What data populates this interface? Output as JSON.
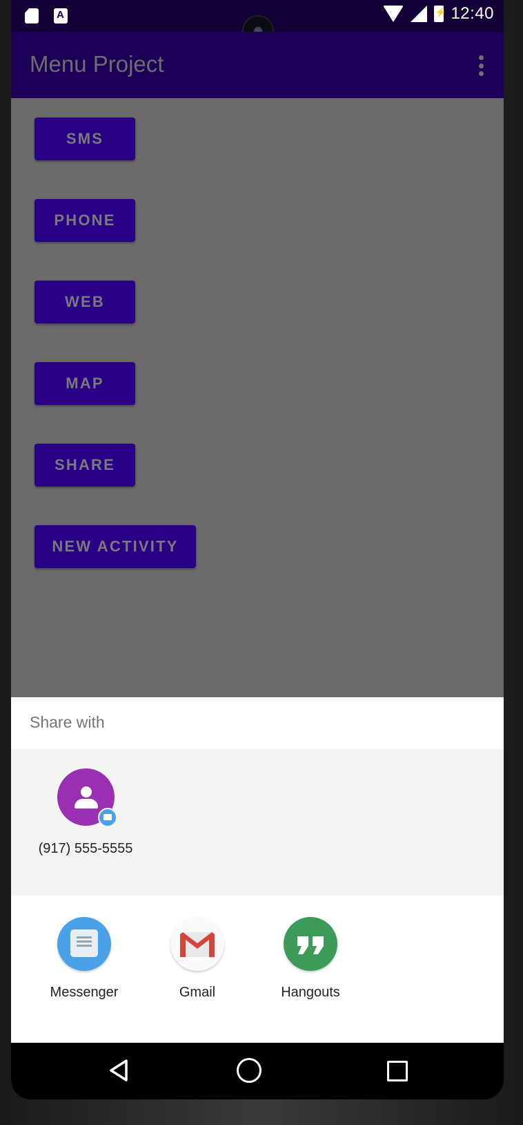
{
  "status_bar": {
    "time": "12:40"
  },
  "app_bar": {
    "title": "Menu Project"
  },
  "buttons": [
    {
      "label": "SMS"
    },
    {
      "label": "PHONE"
    },
    {
      "label": "WEB"
    },
    {
      "label": "MAP"
    },
    {
      "label": "SHARE"
    },
    {
      "label": "NEW ACTIVITY"
    }
  ],
  "share_sheet": {
    "title": "Share with",
    "direct_targets": [
      {
        "label": "(917) 555-5555"
      }
    ],
    "apps": [
      {
        "label": "Messenger",
        "icon": "messenger-icon"
      },
      {
        "label": "Gmail",
        "icon": "gmail-icon"
      },
      {
        "label": "Hangouts",
        "icon": "hangouts-icon"
      }
    ]
  },
  "colors": {
    "status_bar": "#130036",
    "app_bar": "#1d0058",
    "button": "#2a0087",
    "scrim": "#6b6b6b",
    "contact_avatar": "#9a2fb1"
  }
}
